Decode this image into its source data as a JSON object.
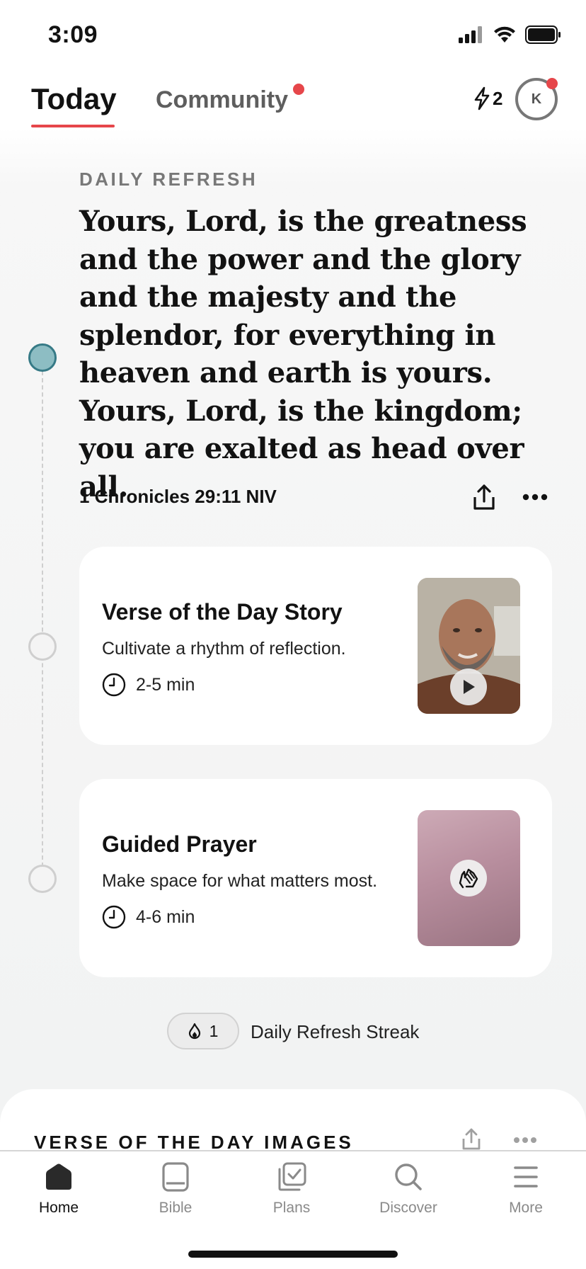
{
  "status_bar": {
    "time": "3:09"
  },
  "header": {
    "tabs": [
      {
        "label": "Today",
        "active": true
      },
      {
        "label": "Community",
        "active": false,
        "has_notification": true
      }
    ],
    "streak_count": "2",
    "avatar_initial": "K"
  },
  "daily_refresh": {
    "section_label": "DAILY REFRESH",
    "verse": "Yours, Lord, is the greatness and the power and the glory and the majesty and the splendor, for everything in heaven and earth is yours. Yours, Lord, is the kingdom; you are exalted as head over all.",
    "reference": "1 Chronicles 29:11 NIV"
  },
  "cards": [
    {
      "title": "Verse of the Day Story",
      "subtitle": "Cultivate a rhythm of reflection.",
      "duration": "2-5 min",
      "thumbnail_icon": "play-icon"
    },
    {
      "title": "Guided Prayer",
      "subtitle": "Make space for what matters most.",
      "duration": "4-6 min",
      "thumbnail_icon": "praying-hands-icon"
    }
  ],
  "streak": {
    "count": "1",
    "label": "Daily Refresh Streak"
  },
  "sheet": {
    "title": "VERSE OF THE DAY IMAGES"
  },
  "tabbar": {
    "items": [
      {
        "label": "Home",
        "icon": "home-icon",
        "active": true
      },
      {
        "label": "Bible",
        "icon": "bible-icon",
        "active": false
      },
      {
        "label": "Plans",
        "icon": "plans-icon",
        "active": false
      },
      {
        "label": "Discover",
        "icon": "search-icon",
        "active": false
      },
      {
        "label": "More",
        "icon": "menu-icon",
        "active": false
      }
    ]
  },
  "colors": {
    "accent_red": "#e6464a",
    "timeline_active": "#8dbdc3",
    "timeline_active_border": "#367a86"
  }
}
